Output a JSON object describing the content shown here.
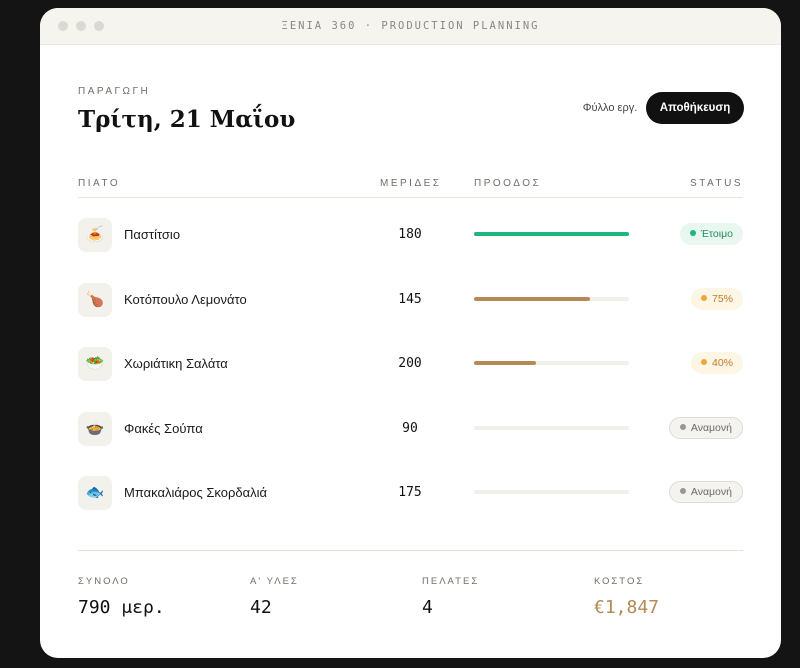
{
  "window": {
    "title": "ΞΕΝΙΑ 360 · PRODUCTION PLANNING"
  },
  "header": {
    "kicker": "ΠΑΡΑΓΩΓΗ",
    "date": "Τρίτη, 21 Μαΐου",
    "worksheet_label": "Φύλλο εργ.",
    "save_label": "Αποθήκευση"
  },
  "table": {
    "columns": {
      "dish": "ΠΙΑΤΟ",
      "portions": "ΜΕΡΙΔΕΣ",
      "progress": "ΠΡΟΟΔΟΣ",
      "status": "STATUS"
    },
    "rows": [
      {
        "icon": "pastitsio-icon",
        "glyph": "🍝",
        "name": "Παστίτσιο",
        "portions": "180",
        "progress": 1.0,
        "bar_color": "#1db67d",
        "status": "Έτοιμο",
        "status_type": "ready"
      },
      {
        "icon": "chicken-leg-icon",
        "glyph": "🍗",
        "name": "Κοτόπουλο Λεμονάτο",
        "portions": "145",
        "progress": 0.75,
        "bar_color": "#b58a57",
        "status": "75%",
        "status_type": "progress"
      },
      {
        "icon": "salad-icon",
        "glyph": "🥗",
        "name": "Χωριάτικη Σαλάτα",
        "portions": "200",
        "progress": 0.4,
        "bar_color": "#b58a57",
        "status": "40%",
        "status_type": "progress"
      },
      {
        "icon": "soup-bowl-icon",
        "glyph": "🍲",
        "name": "Φακές Σούπα",
        "portions": "90",
        "progress": 0,
        "bar_color": "#b58a57",
        "status": "Αναμονή",
        "status_type": "waiting"
      },
      {
        "icon": "fish-icon",
        "glyph": "🐟",
        "name": "Μπακαλιάρος Σκορδαλιά",
        "portions": "175",
        "progress": 0,
        "bar_color": "#b58a57",
        "status": "Αναμονή",
        "status_type": "waiting"
      }
    ]
  },
  "summary": {
    "total_label": "ΣΥΝΟΛΟ",
    "total_value": "790 μερ.",
    "materials_label": "Α' ΥΛΕΣ",
    "materials_value": "42",
    "clients_label": "ΠΕΛΑΤΕΣ",
    "clients_value": "4",
    "cost_label": "ΚΟΣΤΟΣ",
    "cost_value": "€1,847"
  },
  "colors": {
    "ready": "#1db67d",
    "progress": "#b58a57",
    "cost": "#b48a55"
  }
}
